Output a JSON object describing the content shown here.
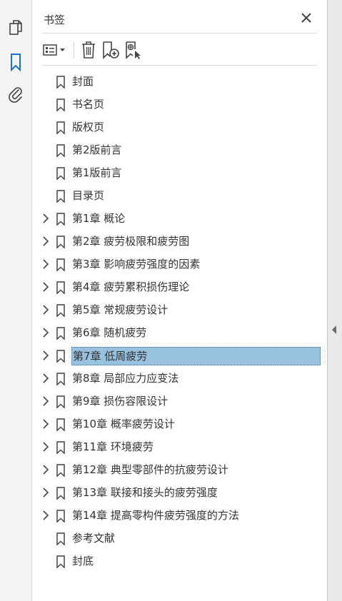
{
  "panel": {
    "title": "书签",
    "close_icon": "close-icon"
  },
  "toolbar": {
    "items": [
      "options-menu-icon",
      "delete-icon",
      "new-bookmark-icon",
      "bookmark-from-selection-icon"
    ]
  },
  "rail": {
    "items": [
      "pages-icon",
      "bookmarks-icon",
      "attachments-icon"
    ],
    "active": "bookmarks-icon",
    "accent": "#1a73c8"
  },
  "bookmarks": [
    {
      "label": "封面",
      "expandable": false
    },
    {
      "label": "书名页",
      "expandable": false
    },
    {
      "label": "版权页",
      "expandable": false
    },
    {
      "label": "第2版前言",
      "expandable": false
    },
    {
      "label": "第1版前言",
      "expandable": false
    },
    {
      "label": "目录页",
      "expandable": false
    },
    {
      "label": "第1章  概论",
      "expandable": true
    },
    {
      "label": "第2章  疲劳极限和疲劳图",
      "expandable": true
    },
    {
      "label": "第3章  影响疲劳强度的因素",
      "expandable": true
    },
    {
      "label": "第4章  疲劳累积损伤理论",
      "expandable": true
    },
    {
      "label": "第5章  常规疲劳设计",
      "expandable": true
    },
    {
      "label": "第6章  随机疲劳",
      "expandable": true
    },
    {
      "label": "第7章  低周疲劳",
      "expandable": true,
      "selected": true
    },
    {
      "label": "第8章  局部应力应变法",
      "expandable": true
    },
    {
      "label": "第9章  损伤容限设计",
      "expandable": true
    },
    {
      "label": "第10章  概率疲劳设计",
      "expandable": true
    },
    {
      "label": "第11章  环境疲劳",
      "expandable": true
    },
    {
      "label": "第12章  典型零部件的抗疲劳设计",
      "expandable": true
    },
    {
      "label": "第13章  联接和接头的疲劳强度",
      "expandable": true
    },
    {
      "label": "第14章  提高零构件疲劳强度的方法",
      "expandable": true
    },
    {
      "label": "参考文献",
      "expandable": false
    },
    {
      "label": "封底",
      "expandable": false
    }
  ],
  "selection_color": "#97c1de"
}
